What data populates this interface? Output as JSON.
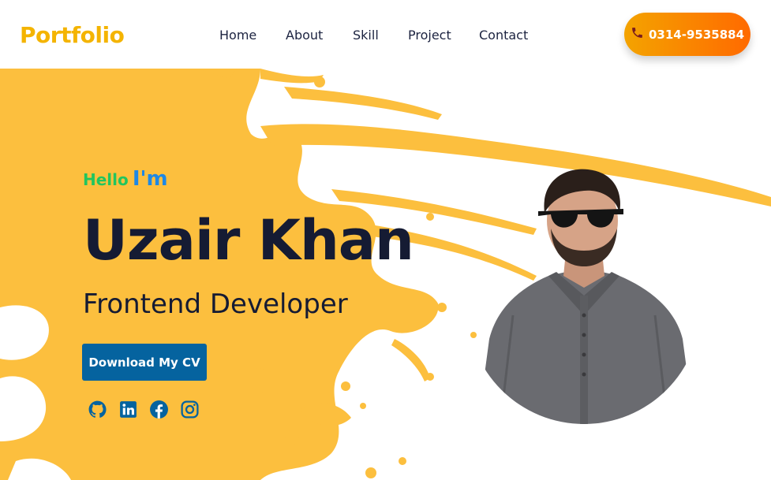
{
  "header": {
    "logo": "Portfolio",
    "nav": [
      {
        "label": "Home",
        "icon": ""
      },
      {
        "label": "About",
        "icon": ""
      },
      {
        "label": "Skill",
        "icon": ""
      },
      {
        "label": "Project",
        "icon": ""
      },
      {
        "label": "Contact",
        "icon": ""
      }
    ],
    "phone_button": {
      "label": "0314-9535884",
      "icon": "phone-icon"
    }
  },
  "hero": {
    "greeting_part1": "Hello",
    "greeting_part2": "I'm",
    "name": "Uzair Khan",
    "role": "Frontend Developer",
    "cv_button": "Download My CV",
    "socials": [
      "github-icon",
      "linkedin-icon",
      "facebook-icon",
      "instagram-icon"
    ]
  },
  "colors": {
    "accent": "#f4b400",
    "splash": "#fcbf3e",
    "cv_button": "#05639f",
    "text_dark": "#151b33",
    "hello_green": "#22c55e",
    "hello_blue": "#1e88e5",
    "phone_gradient_start": "#f4a300",
    "phone_gradient_end": "#ff6a00"
  }
}
